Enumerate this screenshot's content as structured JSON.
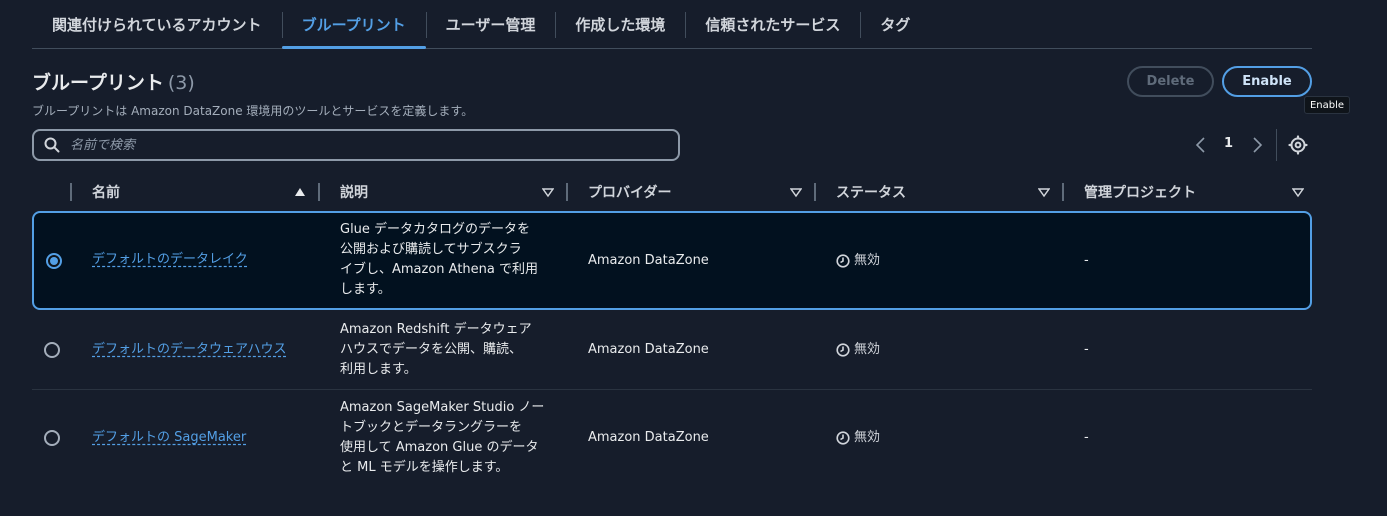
{
  "tabs": [
    {
      "label": "関連付けられているアカウント",
      "active": false
    },
    {
      "label": "ブループリント",
      "active": true
    },
    {
      "label": "ユーザー管理",
      "active": false
    },
    {
      "label": "作成した環境",
      "active": false
    },
    {
      "label": "信頼されたサービス",
      "active": false
    },
    {
      "label": "タグ",
      "active": false
    }
  ],
  "header": {
    "title": "ブループリント",
    "count": "(3)",
    "description": "ブループリントは Amazon DataZone 環境用のツールとサービスを定義します。",
    "delete_label": "Delete",
    "enable_label": "Enable",
    "tooltip": "Enable"
  },
  "search": {
    "placeholder": "名前で検索",
    "value": ""
  },
  "pagination": {
    "current_page": "1"
  },
  "table": {
    "columns": [
      "名前",
      "説明",
      "プロバイダー",
      "ステータス",
      "管理プロジェクト"
    ],
    "rows": [
      {
        "selected": true,
        "name": "デフォルトのデータレイク",
        "description_lines": [
          "Glue データカタログのデータを",
          "公開および購読してサブスクラ",
          "イブし、Amazon Athena で利用",
          "します。"
        ],
        "provider": "Amazon DataZone",
        "status": "無効",
        "project": "-"
      },
      {
        "selected": false,
        "name": "デフォルトのデータウェアハウス",
        "description_lines": [
          "Amazon Redshift データウェア",
          "ハウスでデータを公開、購読、",
          "利用します。"
        ],
        "provider": "Amazon DataZone",
        "status": "無効",
        "project": "-"
      },
      {
        "selected": false,
        "name": "デフォルトの SageMaker",
        "description_lines": [
          "Amazon SageMaker Studio ノー",
          "トブックとデータラングラーを",
          "使用して Amazon Glue のデータ",
          "と ML モデルを操作します。"
        ],
        "provider": "Amazon DataZone",
        "status": "無効",
        "project": "-"
      }
    ]
  },
  "colors": {
    "background": "#161d2b",
    "accent": "#539fe5",
    "selected_row_bg": "#02111f"
  },
  "icons": {
    "search": "search-icon",
    "settings": "gear-icon",
    "status": "clock-icon",
    "prev": "chevron-left-icon",
    "next": "chevron-right-icon"
  }
}
